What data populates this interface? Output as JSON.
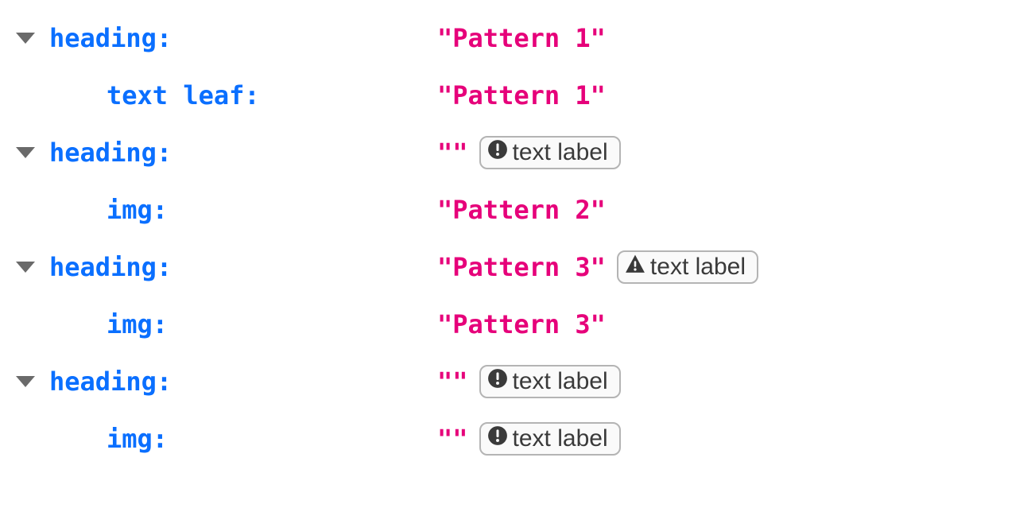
{
  "rows": [
    {
      "indent": 0,
      "expandable": true,
      "type": "heading:",
      "value": "\"Pattern 1\"",
      "badge": null
    },
    {
      "indent": 1,
      "expandable": false,
      "type": "text leaf:",
      "value": "\"Pattern 1\"",
      "badge": null
    },
    {
      "indent": 0,
      "expandable": true,
      "type": "heading:",
      "value": "\"\"",
      "badge": {
        "icon": "error",
        "label": "text label"
      }
    },
    {
      "indent": 1,
      "expandable": false,
      "type": "img:",
      "value": "\"Pattern 2\"",
      "badge": null
    },
    {
      "indent": 0,
      "expandable": true,
      "type": "heading:",
      "value": "\"Pattern 3\"",
      "badge": {
        "icon": "warning",
        "label": "text label"
      }
    },
    {
      "indent": 1,
      "expandable": false,
      "type": "img:",
      "value": "\"Pattern 3\"",
      "badge": null
    },
    {
      "indent": 0,
      "expandable": true,
      "type": "heading:",
      "value": "\"\"",
      "badge": {
        "icon": "error",
        "label": "text label"
      }
    },
    {
      "indent": 1,
      "expandable": false,
      "type": "img:",
      "value": "\"\"",
      "badge": {
        "icon": "error",
        "label": "text label"
      }
    }
  ]
}
